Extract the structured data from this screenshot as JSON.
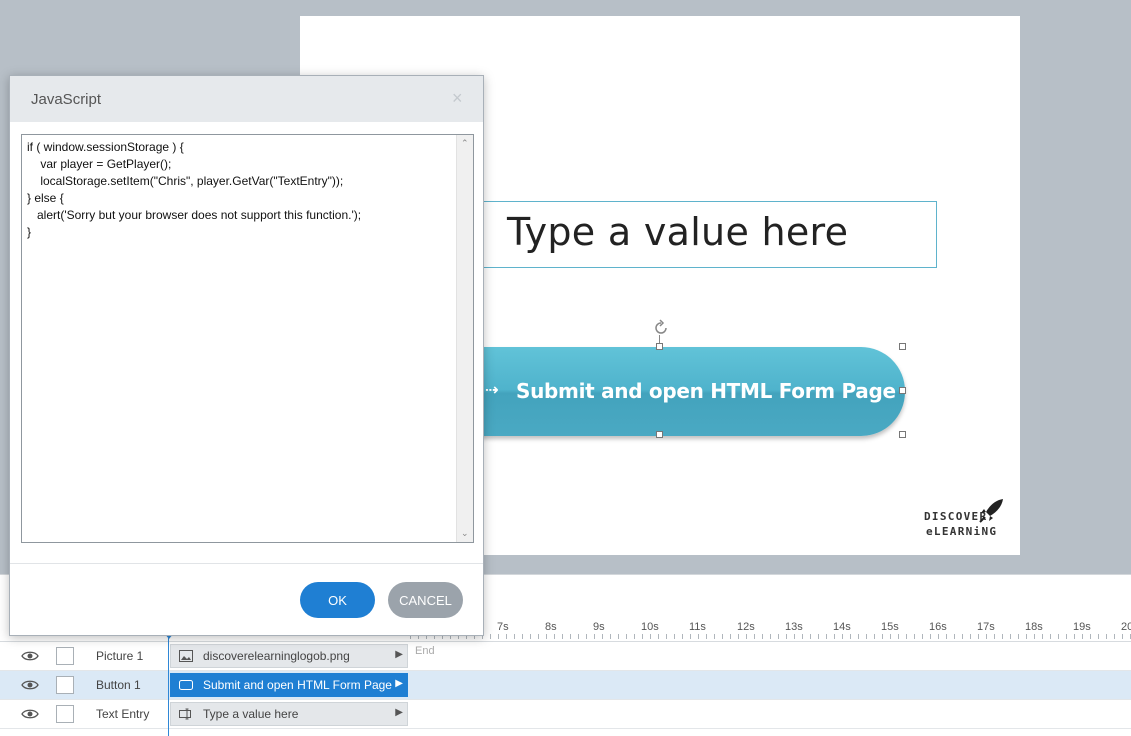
{
  "slide": {
    "text_entry_placeholder": "Type a value here",
    "button_label": "Submit and open HTML Form Page",
    "logo_line1": "DISCOVER",
    "logo_line2": "eLEARNiNG"
  },
  "timeline": {
    "ticks": [
      "7s",
      "8s",
      "9s",
      "10s",
      "11s",
      "12s",
      "13s",
      "14s",
      "15s",
      "16s",
      "17s",
      "18s",
      "19s",
      "20"
    ],
    "end_label": "End",
    "rows": [
      {
        "name": "Picture 1",
        "bar_label": "discoverelearninglogob.png",
        "icon": "image-icon",
        "selected": false
      },
      {
        "name": "Button 1",
        "bar_label": "Submit and open HTML Form Page",
        "icon": "button-icon",
        "selected": true
      },
      {
        "name": "Text Entry",
        "bar_label": "Type a value here",
        "icon": "text-entry-icon",
        "selected": false
      }
    ]
  },
  "dialog": {
    "title": "JavaScript",
    "close_symbol": "×",
    "code_lines": [
      "if ( window.sessionStorage ) {",
      "    var player = GetPlayer();",
      "    localStorage.setItem(\"Chris\", player.GetVar(\"TextEntry\"));",
      "} else {",
      "   alert('Sorry but your browser does not support this function.');",
      "}"
    ],
    "ok_label": "OK",
    "cancel_label": "CANCEL"
  },
  "colors": {
    "accent": "#1f7fd3",
    "button_teal": "#4fb3cc",
    "cancel_gray": "#9ba3ab"
  }
}
